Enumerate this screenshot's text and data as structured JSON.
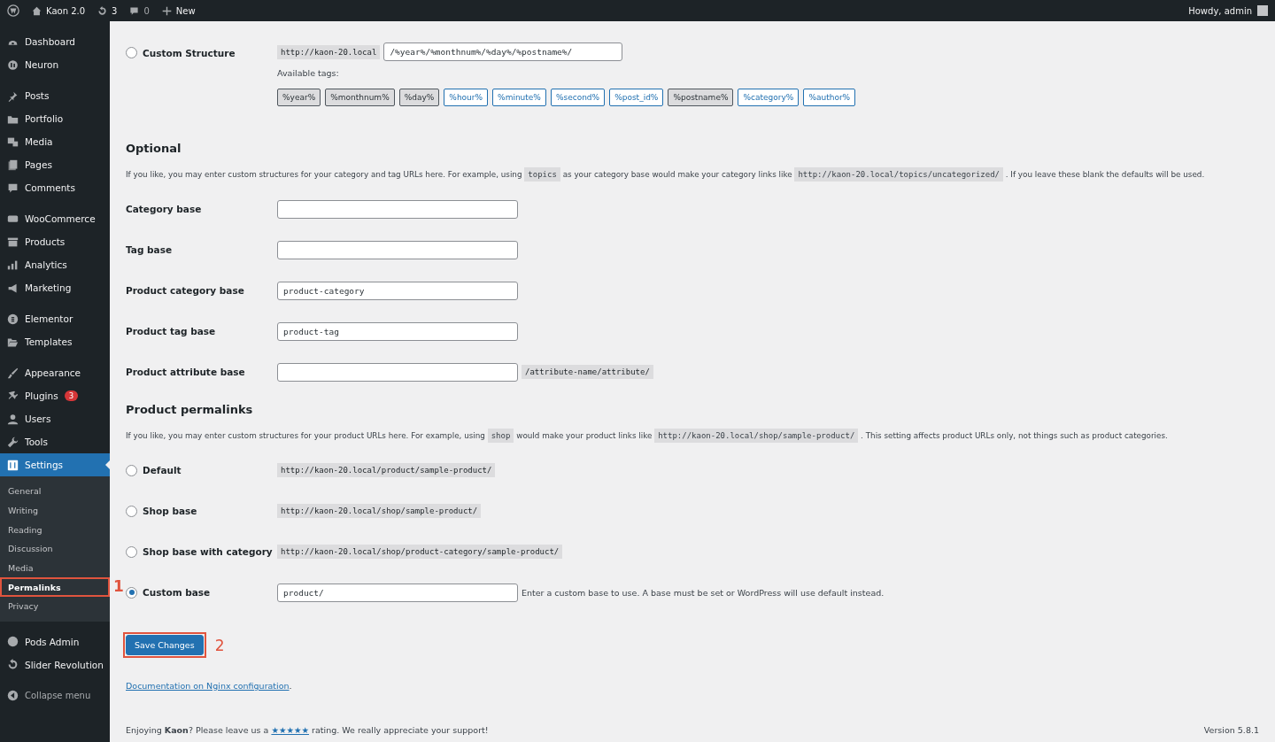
{
  "admin_bar": {
    "site": "Kaon 2.0",
    "updates": "3",
    "comments": "0",
    "new": "New",
    "greeting": "Howdy, admin"
  },
  "sidebar": {
    "groups": [
      [
        {
          "label": "Dashboard",
          "selected": false
        },
        {
          "label": "Neuron",
          "selected": false
        }
      ],
      [
        {
          "label": "Posts",
          "selected": false
        },
        {
          "label": "Portfolio",
          "selected": false
        },
        {
          "label": "Media",
          "selected": false
        },
        {
          "label": "Pages",
          "selected": false
        },
        {
          "label": "Comments",
          "selected": false
        }
      ],
      [
        {
          "label": "WooCommerce",
          "selected": false
        },
        {
          "label": "Products",
          "selected": false
        },
        {
          "label": "Analytics",
          "selected": false
        },
        {
          "label": "Marketing",
          "selected": false
        }
      ],
      [
        {
          "label": "Elementor",
          "selected": false
        },
        {
          "label": "Templates",
          "selected": false
        }
      ],
      [
        {
          "label": "Appearance",
          "selected": false
        },
        {
          "label": "Plugins",
          "selected": false,
          "badge": "3"
        },
        {
          "label": "Users",
          "selected": false
        },
        {
          "label": "Tools",
          "selected": false
        },
        {
          "label": "Settings",
          "selected": true,
          "expanded": true,
          "children": [
            {
              "label": "General",
              "selected": false
            },
            {
              "label": "Writing",
              "selected": false
            },
            {
              "label": "Reading",
              "selected": false
            },
            {
              "label": "Discussion",
              "selected": false
            },
            {
              "label": "Media",
              "selected": false
            },
            {
              "label": "Permalinks",
              "selected": true,
              "annotation": "1"
            },
            {
              "label": "Privacy",
              "selected": false
            }
          ]
        }
      ],
      [
        {
          "label": "Pods Admin",
          "selected": false
        },
        {
          "label": "Slider Revolution",
          "selected": false
        }
      ]
    ],
    "collapse": "Collapse menu"
  },
  "custom_structure": {
    "label": "Custom Structure",
    "selected": false,
    "prefix": "http://kaon-20.local",
    "value": "/%year%/%monthnum%/%day%/%postname%/",
    "tags_label": "Available tags:",
    "tags": [
      {
        "label": "%year%",
        "selected": true
      },
      {
        "label": "%monthnum%",
        "selected": true
      },
      {
        "label": "%day%",
        "selected": true
      },
      {
        "label": "%hour%",
        "selected": false
      },
      {
        "label": "%minute%",
        "selected": false
      },
      {
        "label": "%second%",
        "selected": false
      },
      {
        "label": "%post_id%",
        "selected": false
      },
      {
        "label": "%postname%",
        "selected": true
      },
      {
        "label": "%category%",
        "selected": false
      },
      {
        "label": "%author%",
        "selected": false
      }
    ]
  },
  "optional": {
    "heading": "Optional",
    "description": [
      {
        "kind": "text",
        "text": "If you like, you may enter custom structures for your category and tag URLs here. For example, using"
      },
      {
        "kind": "code",
        "text": "topics"
      },
      {
        "kind": "text",
        "text": "as your category base would make your category links like"
      },
      {
        "kind": "code",
        "text": "http://kaon-20.local/topics/uncategorized/"
      },
      {
        "kind": "text",
        "text": ". If you leave these blank the defaults will be used."
      }
    ],
    "fields": [
      {
        "label": "Category base"
      },
      {
        "label": "Tag base"
      },
      {
        "label": "Product category base",
        "value": "product-category"
      },
      {
        "label": "Product tag base",
        "value": "product-tag"
      },
      {
        "label": "Product attribute base",
        "suffix": "/attribute-name/attribute/"
      }
    ]
  },
  "product_permalinks": {
    "heading": "Product permalinks",
    "description": [
      {
        "kind": "text",
        "text": "If you like, you may enter custom structures for your product URLs here. For example, using"
      },
      {
        "kind": "code",
        "text": "shop"
      },
      {
        "kind": "text",
        "text": "would make your product links like"
      },
      {
        "kind": "code",
        "text": "http://kaon-20.local/shop/sample-product/"
      },
      {
        "kind": "text",
        "text": ". This setting affects product URLs only, not things such as product categories."
      }
    ],
    "options": [
      {
        "label": "Default",
        "selected": false,
        "example": "http://kaon-20.local/product/sample-product/"
      },
      {
        "label": "Shop base",
        "selected": false,
        "example": "http://kaon-20.local/shop/sample-product/"
      },
      {
        "label": "Shop base with category",
        "selected": false,
        "example": "http://kaon-20.local/shop/product-category/sample-product/"
      },
      {
        "label": "Custom base",
        "selected": true,
        "value": "product/",
        "hint": "Enter a custom base to use. A base must be set or WordPress will use default instead."
      }
    ]
  },
  "save_button": {
    "label": "Save Changes",
    "annotation": "2"
  },
  "doc_link": "Documentation on Nginx configuration",
  "doc_link_suffix": ".",
  "footer": {
    "before": "Enjoying **Kaon**? Please leave us a",
    "rating_link": "★★★★★",
    "after": "rating. We really appreciate your support!",
    "version": "Version 5.8.1"
  }
}
